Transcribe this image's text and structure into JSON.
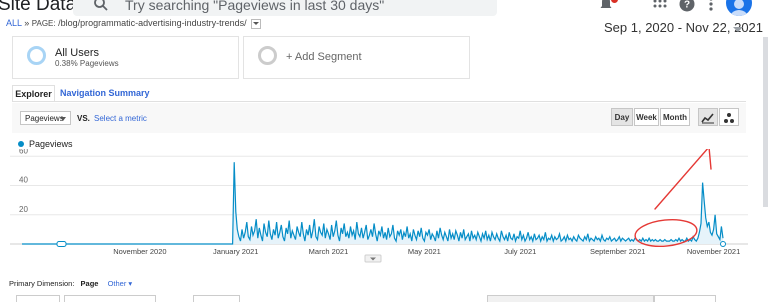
{
  "header": {
    "title": "Site Data",
    "search_placeholder": "Try searching \"Pageviews in last 30 days\""
  },
  "breadcrumb": {
    "all": "ALL",
    "separator": "»",
    "label": "PAGE:",
    "value": "/blog/programmatic-advertising-industry-trends/"
  },
  "date_range": "Sep 1, 2020 - Nov 22, 2021",
  "segments": {
    "all_users": {
      "name": "All Users",
      "sub": "0.38% Pageviews"
    },
    "add_segment": "+ Add Segment"
  },
  "tabs": {
    "explorer": "Explorer",
    "navigation_summary": "Navigation Summary"
  },
  "controls": {
    "metric": "Pageviews",
    "vs": "VS.",
    "select_metric": "Select a metric",
    "day": "Day",
    "week": "Week",
    "month": "Month",
    "selected_granularity": "Day"
  },
  "legend": {
    "series": "Pageviews"
  },
  "chart_data": {
    "type": "line",
    "series": [
      {
        "name": "Pageviews",
        "start_date": "2020-09-01",
        "values": [
          0,
          0,
          0,
          0,
          0,
          0,
          0,
          0,
          0,
          0,
          0,
          0,
          0,
          0,
          0,
          0,
          0,
          0,
          0,
          0,
          0,
          0,
          0,
          0,
          0,
          0,
          0,
          0,
          0,
          0,
          0,
          0,
          0,
          0,
          0,
          0,
          0,
          0,
          0,
          0,
          0,
          0,
          0,
          0,
          0,
          0,
          0,
          0,
          0,
          0,
          0,
          0,
          0,
          0,
          0,
          0,
          0,
          0,
          0,
          0,
          0,
          0,
          0,
          0,
          0,
          0,
          0,
          0,
          0,
          0,
          0,
          0,
          0,
          0,
          0,
          0,
          0,
          0,
          0,
          0,
          0,
          0,
          0,
          0,
          0,
          0,
          0,
          0,
          0,
          0,
          0,
          0,
          0,
          0,
          0,
          0,
          0,
          0,
          0,
          0,
          0,
          0,
          0,
          0,
          0,
          0,
          0,
          0,
          0,
          0,
          0,
          0,
          0,
          0,
          0,
          0,
          0,
          0,
          0,
          0,
          0,
          0,
          0,
          0,
          0,
          0,
          0,
          0,
          0,
          0,
          0,
          0,
          0,
          0,
          0,
          56,
          22,
          10,
          5,
          2,
          10,
          4,
          8,
          15,
          5,
          3,
          12,
          6,
          9,
          17,
          4,
          11,
          6,
          2,
          14,
          8,
          5,
          16,
          7,
          3,
          10,
          6,
          15,
          4,
          8,
          13,
          5,
          2,
          11,
          7,
          16,
          4,
          9,
          6,
          3,
          12,
          8,
          5,
          15,
          7,
          2,
          10,
          6,
          13,
          4,
          9,
          17,
          5,
          3,
          12,
          8,
          6,
          14,
          4,
          10,
          7,
          3,
          13,
          5,
          9,
          16,
          6,
          2,
          11,
          7,
          14,
          5,
          8,
          4,
          12,
          6,
          9,
          3,
          15,
          7,
          5,
          11,
          4,
          8,
          13,
          3,
          6,
          10,
          5,
          14,
          7,
          2,
          9,
          6,
          12,
          4,
          8,
          3,
          11,
          5,
          7,
          13,
          4,
          2,
          9,
          6,
          10,
          3,
          8,
          5,
          12,
          4,
          7,
          2,
          10,
          6,
          3,
          9,
          5,
          11,
          4,
          2,
          8,
          6,
          10,
          3,
          7,
          5,
          2,
          9,
          4,
          11,
          6,
          3,
          8,
          5,
          2,
          10,
          4,
          7,
          3,
          9,
          6,
          2,
          8,
          4,
          10,
          3,
          5,
          7,
          2,
          9,
          4,
          6,
          3,
          8,
          5,
          2,
          7,
          4,
          9,
          3,
          6,
          2,
          8,
          5,
          3,
          7,
          4,
          2,
          9,
          5,
          3,
          6,
          2,
          8,
          4,
          3,
          7,
          2,
          5,
          4,
          9,
          3,
          6,
          2,
          4,
          8,
          3,
          5,
          2,
          7,
          3,
          4,
          6,
          2,
          5,
          3,
          8,
          2,
          4,
          3,
          6,
          2,
          5,
          3,
          4,
          7,
          2,
          3,
          5,
          2,
          6,
          3,
          4,
          2,
          5,
          3,
          2,
          6,
          4,
          3,
          2,
          5,
          3,
          7,
          2,
          4,
          3,
          2,
          5,
          3,
          4,
          2,
          6,
          3,
          2,
          4,
          3,
          5,
          2,
          3,
          4,
          2,
          3,
          5,
          2,
          4,
          3,
          2,
          3,
          4,
          2,
          3,
          2,
          4,
          3,
          2,
          3,
          2,
          4,
          2,
          3,
          2,
          4,
          2,
          3,
          2,
          3,
          2,
          2,
          3,
          2,
          2,
          3,
          2,
          2,
          2,
          3,
          2,
          2,
          3,
          2,
          4,
          2,
          3,
          2,
          2,
          4,
          2,
          3,
          2,
          5,
          3,
          2,
          4,
          8,
          14,
          42,
          30,
          18,
          12,
          15,
          8,
          6,
          10,
          20,
          7,
          5,
          3,
          12,
          4
        ]
      }
    ],
    "x_tick_labels": [
      "November 2020",
      "January 2021",
      "March 2021",
      "May 2021",
      "July 2021",
      "September 2021",
      "November 2021"
    ],
    "y_tick_labels": [
      "20",
      "40",
      "60"
    ],
    "ylim": [
      0,
      65
    ],
    "grid": true
  },
  "primary_dimension": {
    "label": "Primary Dimension:",
    "current": "Page",
    "other": "Other"
  },
  "colors": {
    "series": "#058dc7",
    "area": "#e6f3fa",
    "link": "#3367d6",
    "annotation": "#e53935"
  },
  "icons": [
    "search-icon",
    "notifications-icon",
    "apps-icon",
    "help-icon",
    "more-vert-icon",
    "avatar",
    "line-chart-icon",
    "motion-chart-icon"
  ]
}
